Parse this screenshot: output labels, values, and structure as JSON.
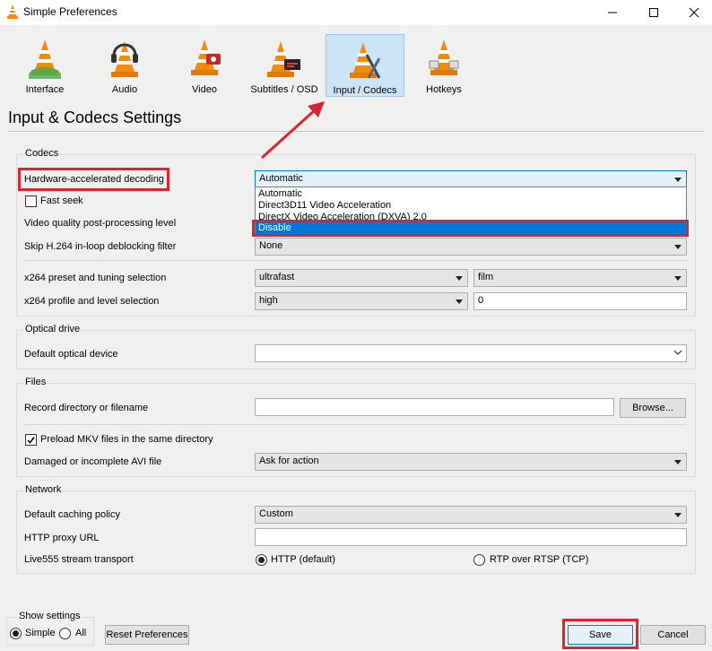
{
  "window": {
    "title": "Simple Preferences"
  },
  "toolbar": {
    "items": [
      {
        "label": "Interface"
      },
      {
        "label": "Audio"
      },
      {
        "label": "Video"
      },
      {
        "label": "Subtitles / OSD"
      },
      {
        "label": "Input / Codecs"
      },
      {
        "label": "Hotkeys"
      }
    ]
  },
  "page": {
    "heading": "Input & Codecs Settings"
  },
  "codecs": {
    "title": "Codecs",
    "hw_label": "Hardware-accelerated decoding",
    "hw_value": "Automatic",
    "hw_options": [
      "Automatic",
      "Direct3D11 Video Acceleration",
      "DirectX Video Acceleration (DXVA) 2.0",
      "Disable"
    ],
    "fast_seek_label": "Fast seek",
    "vq_label": "Video quality post-processing level",
    "skip_label": "Skip H.264 in-loop deblocking filter",
    "skip_value": "None",
    "x264_preset_label": "x264 preset and tuning selection",
    "x264_preset_value": "ultrafast",
    "x264_tune_value": "film",
    "x264_profile_label": "x264 profile and level selection",
    "x264_profile_value": "high",
    "x264_level_value": "0"
  },
  "optical": {
    "title": "Optical drive",
    "device_label": "Default optical device",
    "device_value": ""
  },
  "files": {
    "title": "Files",
    "record_label": "Record directory or filename",
    "record_value": "",
    "browse_label": "Browse...",
    "preload_label": "Preload MKV files in the same directory",
    "damaged_label": "Damaged or incomplete AVI file",
    "damaged_value": "Ask for action"
  },
  "network": {
    "title": "Network",
    "caching_label": "Default caching policy",
    "caching_value": "Custom",
    "proxy_label": "HTTP proxy URL",
    "proxy_value": "",
    "transport_label": "Live555 stream transport",
    "http_label": "HTTP (default)",
    "rtp_label": "RTP over RTSP (TCP)"
  },
  "footer": {
    "show_settings_label": "Show settings",
    "simple_label": "Simple",
    "all_label": "All",
    "reset_label": "Reset Preferences",
    "save_label": "Save",
    "cancel_label": "Cancel"
  },
  "colors": {
    "accent": "#0078d7",
    "highlight_box": "#d7262f",
    "selected_tab": "#cce4f7"
  }
}
